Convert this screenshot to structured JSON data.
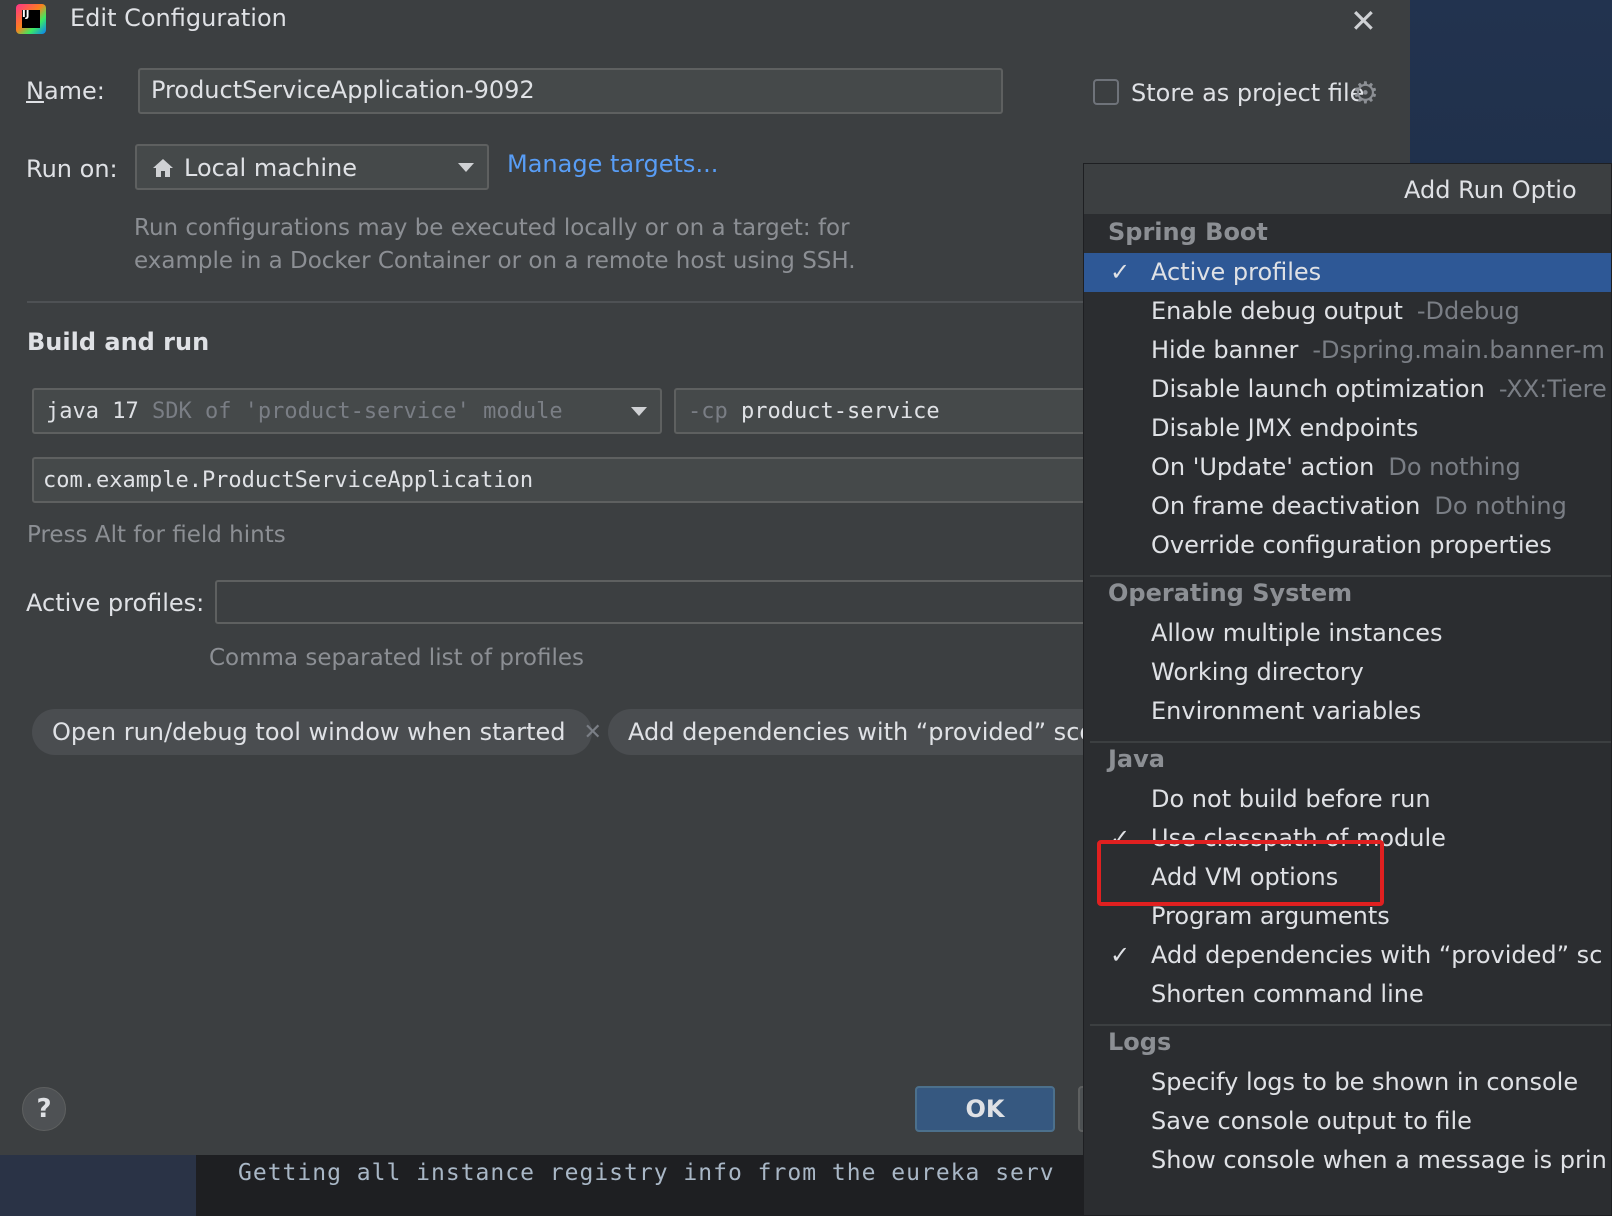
{
  "window": {
    "title": "Edit Configuration",
    "app_logo_text": "IJ"
  },
  "form": {
    "name_label": "Name:",
    "name_value": "ProductServiceApplication-9092",
    "store_label": "Store as project file",
    "store_checked": false,
    "run_on_label": "Run on:",
    "run_on_value": "Local machine",
    "manage_targets": "Manage targets...",
    "run_on_hint_line1": "Run configurations may be executed locally or on a target: for",
    "run_on_hint_line2": "example in a Docker Container or on a remote host using SSH.",
    "section_title": "Build and run",
    "jdk_value": "java 17",
    "jdk_hint": "SDK of 'product-service' module",
    "cp_prefix": "-cp",
    "cp_value": "product-service",
    "main_class": "com.example.ProductServiceApplication",
    "field_hints": "Press Alt for field hints",
    "active_profiles_label": "Active profiles:",
    "active_profiles_value": "",
    "active_profiles_hint": "Comma separated list of profiles",
    "chip1": "Open run/debug tool window when started",
    "chip2": "Add dependencies with “provided” scope"
  },
  "buttons": {
    "help": "?",
    "ok": "OK"
  },
  "popup": {
    "title": "Add Run Optio",
    "groups": [
      {
        "name": "Spring Boot",
        "items": [
          {
            "label": "Active profiles",
            "sub": "",
            "checked": "✓",
            "selected": true
          },
          {
            "label": "Enable debug output",
            "sub": "-Ddebug",
            "checked": ""
          },
          {
            "label": "Hide banner",
            "sub": "-Dspring.main.banner-m",
            "checked": ""
          },
          {
            "label": "Disable launch optimization",
            "sub": "-XX:Tiere",
            "checked": ""
          },
          {
            "label": "Disable JMX endpoints",
            "sub": "",
            "checked": ""
          },
          {
            "label": "On 'Update' action",
            "sub": "Do nothing",
            "checked": ""
          },
          {
            "label": "On frame deactivation",
            "sub": "Do nothing",
            "checked": ""
          },
          {
            "label": "Override configuration properties",
            "sub": "",
            "checked": ""
          }
        ]
      },
      {
        "name": "Operating System",
        "items": [
          {
            "label": "Allow multiple instances",
            "sub": "",
            "checked": ""
          },
          {
            "label": "Working directory",
            "sub": "",
            "checked": ""
          },
          {
            "label": "Environment variables",
            "sub": "",
            "checked": ""
          }
        ]
      },
      {
        "name": "Java",
        "items": [
          {
            "label": "Do not build before run",
            "sub": "",
            "checked": ""
          },
          {
            "label": "Use classpath of module",
            "sub": "",
            "checked": "✓"
          },
          {
            "label": "Add VM options",
            "sub": "",
            "checked": ""
          },
          {
            "label": "Program arguments",
            "sub": "",
            "checked": ""
          },
          {
            "label": "Add dependencies with “provided” sc",
            "sub": "",
            "checked": "✓"
          },
          {
            "label": "Shorten command line",
            "sub": "",
            "checked": ""
          }
        ]
      },
      {
        "name": "Logs",
        "items": [
          {
            "label": "Specify logs to be shown in console",
            "sub": "",
            "checked": ""
          },
          {
            "label": "Save console output to file",
            "sub": "",
            "checked": ""
          },
          {
            "label": "Show console when a message is prin",
            "sub": "",
            "checked": ""
          }
        ]
      }
    ]
  },
  "background": {
    "terminal_text": "Getting all instance registry info from the eureka serv"
  }
}
